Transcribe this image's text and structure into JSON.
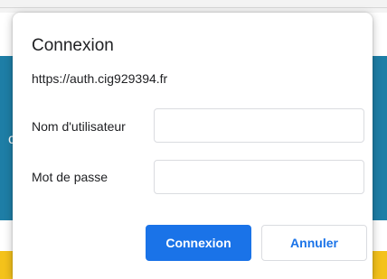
{
  "dialog": {
    "title": "Connexion",
    "url": "https://auth.cig929394.fr",
    "username_label": "Nom d'utilisateur",
    "username_value": "",
    "password_label": "Mot de passe",
    "password_value": "",
    "submit_label": "Connexion",
    "cancel_label": "Annuler"
  },
  "background": {
    "fragment_text": "c"
  },
  "colors": {
    "accent": "#1a73e8",
    "background_band": "#1e7ea6",
    "background_stripe": "#f4c21b"
  }
}
